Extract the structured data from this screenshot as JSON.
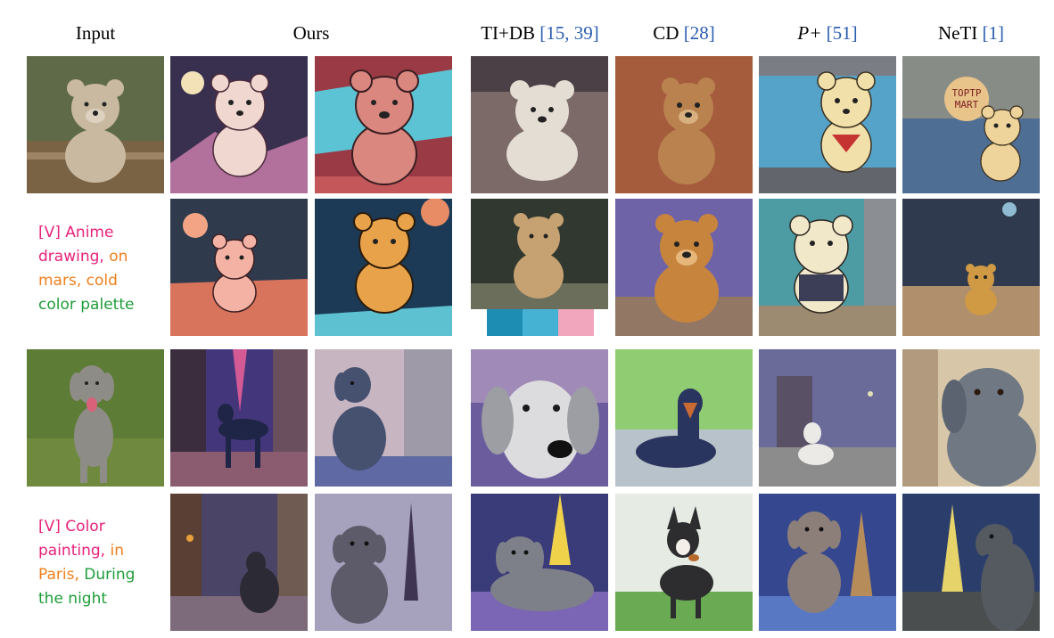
{
  "headers": {
    "input": "Input",
    "ours": "Ours",
    "tidb_name": "TI+DB ",
    "tidb_refs_open": "[",
    "tidb_ref1": "15",
    "tidb_sep": ", ",
    "tidb_ref2": "39",
    "tidb_refs_close": "]",
    "cd_name": "CD ",
    "cd_ref_open": "[",
    "cd_ref": "28",
    "cd_ref_close": "]",
    "pplus_name": "P+ ",
    "pplus_ref_open": "[",
    "pplus_ref": "51",
    "pplus_ref_close": "]",
    "neti_name": "NeTI ",
    "neti_ref_open": "[",
    "neti_ref": "1",
    "neti_ref_close": "]"
  },
  "prompts": [
    {
      "lines": [
        [
          {
            "text": "[V] Anime",
            "color": "#e8217a"
          }
        ],
        [
          {
            "text": "drawing, ",
            "color": "#e8217a"
          },
          {
            "text": "on",
            "color": "#f07f1b"
          }
        ],
        [
          {
            "text": "mars, cold",
            "color": "#f07f1b"
          }
        ],
        [
          {
            "text": "color palette",
            "color": "#1f9d3a"
          }
        ]
      ]
    },
    {
      "lines": [
        [
          {
            "text": "[V] Color",
            "color": "#e8217a"
          }
        ],
        [
          {
            "text": "painting, ",
            "color": "#e8217a"
          },
          {
            "text": "in",
            "color": "#f07f1b"
          }
        ],
        [
          {
            "text": "Paris, ",
            "color": "#f07f1b"
          },
          {
            "text": "During",
            "color": "#1f9d3a"
          }
        ],
        [
          {
            "text": "the night",
            "color": "#1f9d3a"
          }
        ]
      ]
    }
  ],
  "image_watermark": {
    "text_line1": "TOPTP",
    "text_line2": "MART"
  },
  "colors": {
    "ref_blue": "#2a5db0",
    "prompt_pink": "#e8217a",
    "prompt_orange": "#f07f1b",
    "prompt_green": "#1f9d3a"
  }
}
